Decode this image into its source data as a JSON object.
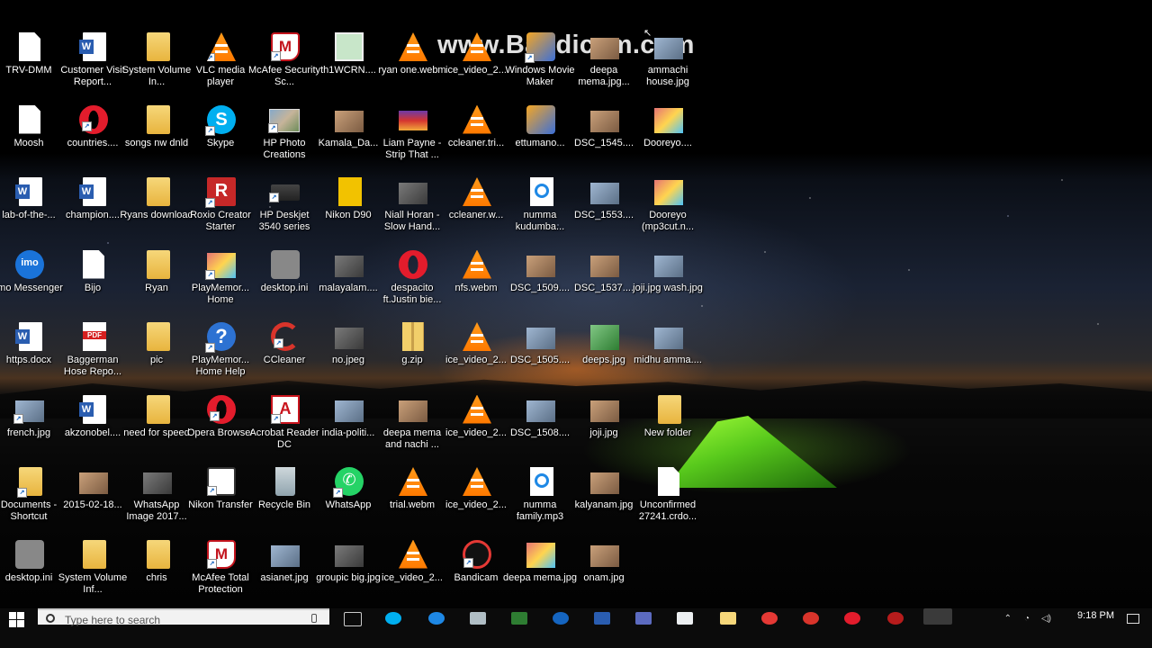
{
  "watermark": "www.Bandicam.com",
  "desktop_icons": {
    "c1": [
      "TRV-DMM",
      "Moosh",
      "lab-of-the-...",
      "Imo Messenger",
      "https.docx",
      "french.jpg",
      "Documents - Shortcut",
      "desktop.ini"
    ],
    "c2": [
      "Customer Visit Report...",
      "countries....",
      "champion....",
      "Bijo",
      "Baggerman Hose Repo...",
      "akzonobel....",
      "2015-02-18...",
      "System Volume Inf..."
    ],
    "c3": [
      "System Volume In...",
      "songs nw dnld",
      "Ryans download",
      "Ryan",
      "pic",
      "need for speed",
      "WhatsApp Image 2017...",
      "chris"
    ],
    "c4": [
      "VLC media player",
      "Skype",
      "Roxio Creator Starter",
      "PlayMemor... Home",
      "PlayMemor... Home Help",
      "Opera Browser",
      "Nikon Transfer",
      "McAfee Total Protection"
    ],
    "c5": [
      "McAfee Security Sc...",
      "HP Photo Creations",
      "HP Deskjet 3540 series",
      "desktop.ini",
      "CCleaner",
      "Acrobat Reader DC",
      "Recycle Bin",
      "asianet.jpg"
    ],
    "c6": [
      "th1WCRN....",
      "Kamala_Da...",
      "Nikon D90",
      "malayalam....",
      "no.jpeg",
      "india-politi...",
      "WhatsApp",
      "groupic big.jpg"
    ],
    "c7": [
      "ryan one.webm",
      "Liam Payne - Strip That ...",
      "Niall Horan - Slow Hand...",
      "despacito ft.Justin bie...",
      "g.zip",
      "deepa mema and nachi ...",
      "trial.webm",
      "ice_video_2..."
    ],
    "c8": [
      "ice_video_2...",
      "ccleaner.tri...",
      "ccleaner.w...",
      "nfs.webm",
      "ice_video_2...",
      "ice_video_2...",
      "ice_video_2...",
      "Bandicam"
    ],
    "c9": [
      "Windows Movie Maker",
      "ettumano...",
      "numma kudumba...",
      "DSC_1509....",
      "DSC_1505....",
      "DSC_1508....",
      "numma family.mp3",
      "deepa mema.jpg"
    ],
    "c10": [
      "deepa mema.jpg...",
      "DSC_1545....",
      "DSC_1553....",
      "DSC_1537....",
      "deeps.jpg",
      "joji.jpg",
      "kalyanam.jpg",
      "onam.jpg"
    ],
    "c11": [
      "ammachi house.jpg",
      "Dooreyo....",
      "Dooreyo (mp3cut.n...",
      "joji.jpg wash.jpg",
      "midhu amma....",
      "New folder",
      "Unconfirmed 27241.crdo..."
    ]
  },
  "taskbar": {
    "search_placeholder": "Type here to search",
    "clock": "9:18 PM"
  },
  "colors": {
    "desktop_bg": "#000000",
    "taskbar_bg": "#0b0b0b",
    "tent_green": "#7fe02a",
    "horizon_orange": "#f07a1e"
  }
}
